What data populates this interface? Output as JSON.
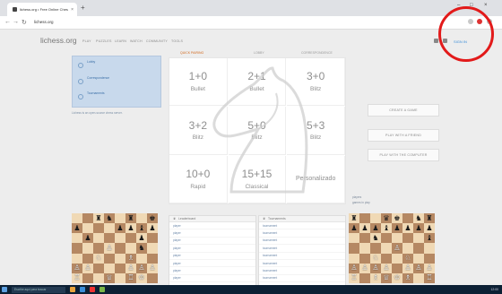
{
  "browser": {
    "tab_title": "lichess.org • Free Online Chess",
    "tab_close": "×",
    "new_tab": "+",
    "url": "lichess.org",
    "window_controls": [
      "–",
      "□",
      "×"
    ],
    "nav_icons": [
      "←",
      "→",
      "↻"
    ]
  },
  "header": {
    "logo": "lichess.org",
    "nav": [
      "PLAY",
      "PUZZLES",
      "LEARN",
      "WATCH",
      "COMMUNITY",
      "TOOLS"
    ],
    "signin": "SIGN IN"
  },
  "left": {
    "items": [
      {
        "title": "Lobby",
        "sub": ""
      },
      {
        "title": "Correspondence",
        "sub": ""
      },
      {
        "title": "Tournaments",
        "sub": ""
      }
    ],
    "about": "Lichess is an open-source chess server."
  },
  "modes": [
    "QUICK PAIRING",
    "LOBBY",
    "CORRESPONDENCE"
  ],
  "pools": [
    {
      "time": "1+0",
      "type": "Bullet"
    },
    {
      "time": "2+1",
      "type": "Bullet"
    },
    {
      "time": "3+0",
      "type": "Blitz"
    },
    {
      "time": "3+2",
      "type": "Blitz"
    },
    {
      "time": "5+0",
      "type": "Blitz"
    },
    {
      "time": "5+3",
      "type": "Blitz"
    },
    {
      "time": "10+0",
      "type": "Rapid"
    },
    {
      "time": "15+15",
      "type": "Classical"
    },
    {
      "time": "Personalizado",
      "type": ""
    }
  ],
  "actions": [
    "CREATE A GAME",
    "PLAY WITH A FRIEND",
    "PLAY WITH THE COMPUTER"
  ],
  "right_text": [
    "players",
    "games in play"
  ],
  "leaderboard": {
    "title": "Leaderboard",
    "rows": [
      {
        "name": "player",
        "rating": "",
        "time": ""
      },
      {
        "name": "player",
        "rating": "",
        "time": ""
      },
      {
        "name": "player",
        "rating": "",
        "time": ""
      },
      {
        "name": "player",
        "rating": "",
        "time": ""
      },
      {
        "name": "player",
        "rating": "",
        "time": ""
      },
      {
        "name": "player",
        "rating": "",
        "time": ""
      },
      {
        "name": "player",
        "rating": "",
        "time": ""
      },
      {
        "name": "player",
        "rating": "",
        "time": ""
      }
    ]
  },
  "tournaments": {
    "title": "Tournaments",
    "rows": [
      {
        "name": "tournament",
        "v": ""
      },
      {
        "name": "tournament",
        "v": ""
      },
      {
        "name": "tournament",
        "v": ""
      },
      {
        "name": "tournament",
        "v": ""
      },
      {
        "name": "tournament",
        "v": ""
      },
      {
        "name": "tournament",
        "v": ""
      },
      {
        "name": "tournament",
        "v": ""
      },
      {
        "name": "tournament",
        "v": ""
      }
    ]
  },
  "boards": {
    "left": [
      "  ♜♞ ♜ ♚",
      "♟   ♟♟♝♟",
      " ♟    ♟ ",
      "   ♙  ♞ ",
      "  ♘  ♗  ",
      "♙♙   ♙♙♙",
      "♖  ♕ ♖♔ "
    ],
    "right": [
      "♜  ♛♚ ♞♜",
      "♟♟♟♝♟♟♟♟",
      "  ♞    ♝",
      "    ♙   ",
      "  ♘  ♘  ",
      "♙♙♙♙ ♙♙♙",
      "♖ ♗♕♔♗ ♖"
    ]
  },
  "taskbar": {
    "search": "Escribe aquí para buscar",
    "time": "12:00"
  }
}
